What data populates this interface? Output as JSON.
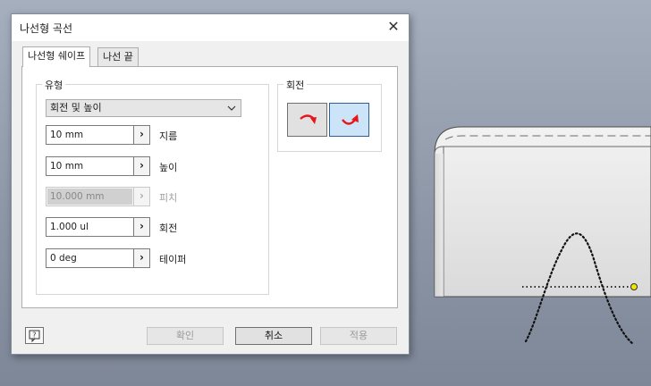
{
  "window": {
    "title": "나선형 곡선",
    "close_icon": "✕"
  },
  "tabs": [
    {
      "label": "나선형 쉐이프",
      "active": true
    },
    {
      "label": "나선 끝",
      "active": false
    }
  ],
  "type_group": {
    "label": "유형",
    "selected": "회전 및 높이",
    "fields": [
      {
        "value": "10 mm",
        "label": "지름",
        "enabled": true
      },
      {
        "value": "10 mm",
        "label": "높이",
        "enabled": true
      },
      {
        "value": "10.000 mm",
        "label": "피치",
        "enabled": false
      },
      {
        "value": "1.000 ul",
        "label": "회전",
        "enabled": true
      },
      {
        "value": "0 deg",
        "label": "테이퍼",
        "enabled": true
      }
    ],
    "arrow_glyph": "›"
  },
  "rotation_group": {
    "label": "회전",
    "buttons": [
      {
        "name": "clockwise-rotation",
        "selected": false
      },
      {
        "name": "counterclockwise-rotation",
        "selected": true
      }
    ]
  },
  "footer": {
    "help_icon": "help-icon",
    "ok_label": "확인",
    "cancel_label": "취소",
    "apply_label": "적용"
  },
  "colors": {
    "accent_selected": "#cce4f7",
    "rotation_arrow": "#e8161a",
    "sketch_point": "#f2e600"
  }
}
